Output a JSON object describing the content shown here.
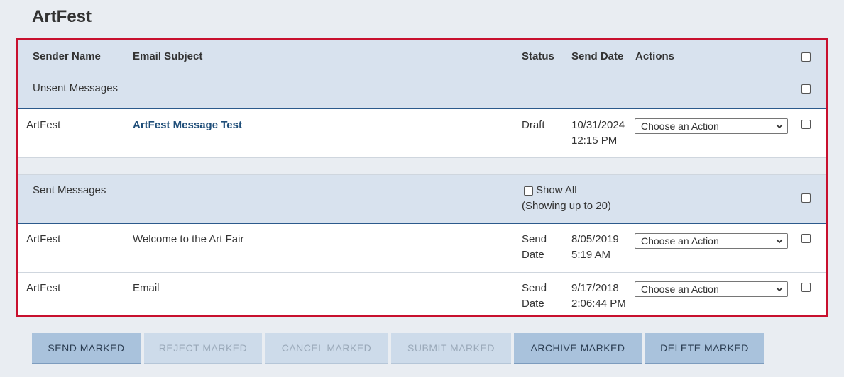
{
  "page": {
    "title": "ArtFest"
  },
  "table": {
    "headers": {
      "sender_name": "Sender Name",
      "email_subject": "Email Subject",
      "status": "Status",
      "send_date": "Send Date",
      "actions": "Actions"
    },
    "unsent_label": "Unsent Messages",
    "unsent_rows": [
      {
        "sender": "ArtFest",
        "subject": "ArtFest Message Test",
        "status": "Draft",
        "date": "10/31/2024",
        "time": "12:15 PM",
        "action": "Choose an Action"
      }
    ],
    "sent_label": "Sent Messages",
    "show_all_label": "Show All",
    "showing_note": "(Showing up to 20)",
    "sent_rows": [
      {
        "sender": "ArtFest",
        "subject": "Welcome to the Art Fair",
        "status_line1": "Send",
        "status_line2": "Date",
        "date": "8/05/2019",
        "time": "5:19 AM",
        "action": "Choose an Action"
      },
      {
        "sender": "ArtFest",
        "subject": "Email",
        "status_line1": "Send",
        "status_line2": "Date",
        "date": "9/17/2018",
        "time": "2:06:44 PM",
        "action": "Choose an Action"
      }
    ]
  },
  "buttons": {
    "send": "SEND MARKED",
    "reject": "REJECT MARKED",
    "cancel": "CANCEL MARKED",
    "submit": "SUBMIT MARKED",
    "archive": "ARCHIVE MARKED",
    "delete": "DELETE MARKED"
  },
  "colors": {
    "frame_border": "#c8102e",
    "header_bg": "#d8e2ee",
    "link": "#1f4e79",
    "button_active": "#a9c2dc",
    "button_disabled": "#cddbea"
  }
}
